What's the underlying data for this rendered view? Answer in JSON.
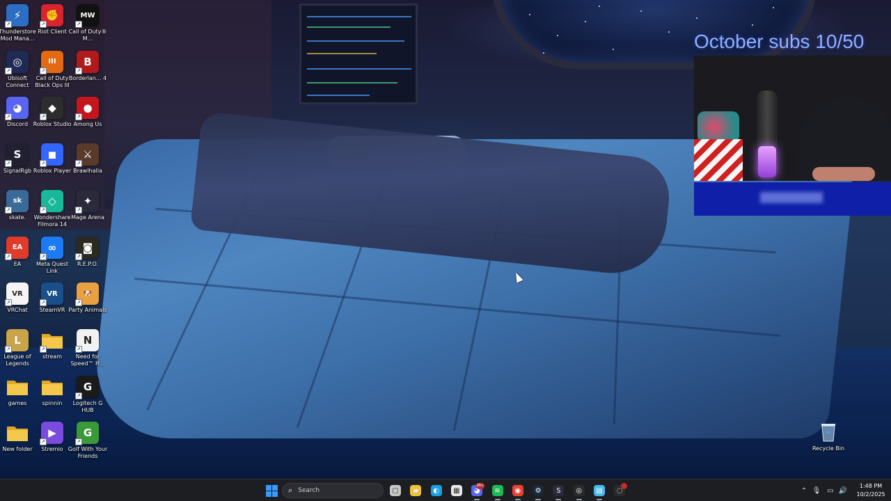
{
  "overlay": {
    "subs_goal_text": "October subs 10/50"
  },
  "desktop_icons": [
    {
      "label": "Thunderstore Mod Mana...",
      "icon": "thunderstore-icon",
      "color": "#2c6ec4",
      "glyph": "⚡"
    },
    {
      "label": "Riot Client",
      "icon": "riot-client-icon",
      "color": "#d8242e",
      "glyph": "✊"
    },
    {
      "label": "Call of Duty® M...",
      "icon": "call-of-duty-mw-icon",
      "color": "#111111",
      "glyph": "MW"
    },
    {
      "label": "Ubisoft Connect",
      "icon": "ubisoft-connect-icon",
      "color": "#1f2a55",
      "glyph": "◎"
    },
    {
      "label": "Call of Duty Black Ops III",
      "icon": "black-ops-3-icon",
      "color": "#e36a12",
      "glyph": "III"
    },
    {
      "label": "Borderlan... 4",
      "icon": "borderlands-icon",
      "color": "#b01a1a",
      "glyph": "B"
    },
    {
      "label": "Discord",
      "icon": "discord-icon",
      "color": "#5865f2",
      "glyph": "◕"
    },
    {
      "label": "Roblox Studio",
      "icon": "roblox-studio-icon",
      "color": "#2d2d2d",
      "glyph": "◆"
    },
    {
      "label": "Among Us",
      "icon": "among-us-icon",
      "color": "#c4161c",
      "glyph": "●"
    },
    {
      "label": "SignalRgb",
      "icon": "signalrgb-icon",
      "color": "#202030",
      "glyph": "S"
    },
    {
      "label": "Roblox Player",
      "icon": "roblox-player-icon",
      "color": "#3366ff",
      "glyph": "◼"
    },
    {
      "label": "Brawlhalla",
      "icon": "brawlhalla-icon",
      "color": "#5a3a2a",
      "glyph": "⚔"
    },
    {
      "label": "skate.",
      "icon": "skate-icon",
      "color": "#3a6a9a",
      "glyph": "sk"
    },
    {
      "label": "Wondershare Filmora 14",
      "icon": "filmora-icon",
      "color": "#18b89a",
      "glyph": "◇"
    },
    {
      "label": "Mage Arena",
      "icon": "mage-arena-icon",
      "color": "#2a2a3a",
      "glyph": "✦"
    },
    {
      "label": "EA",
      "icon": "ea-icon",
      "color": "#e03a2a",
      "glyph": "EA"
    },
    {
      "label": "Meta Quest Link",
      "icon": "meta-quest-link-icon",
      "color": "#1c7bf2",
      "glyph": "∞"
    },
    {
      "label": "R.E.P.O.",
      "icon": "repo-icon",
      "color": "#2a2a20",
      "glyph": "◙"
    },
    {
      "label": "VRChat",
      "icon": "vrchat-icon",
      "color": "#f5f5f5",
      "glyph": "VR"
    },
    {
      "label": "SteamVR",
      "icon": "steamvr-icon",
      "color": "#1b4f8a",
      "glyph": "VR"
    },
    {
      "label": "Party Animals",
      "icon": "party-animals-icon",
      "color": "#e8a040",
      "glyph": "🐶"
    },
    {
      "label": "League of Legends",
      "icon": "league-of-legends-icon",
      "color": "#c8a44a",
      "glyph": "L"
    },
    {
      "label": "stream",
      "icon": "folder-icon",
      "color": "#e9b83a",
      "glyph": ""
    },
    {
      "label": "Need for Speed™ H...",
      "icon": "need-for-speed-icon",
      "color": "#f2f2f2",
      "glyph": "N"
    },
    {
      "label": "games",
      "icon": "folder-icon",
      "color": "#e9b83a",
      "glyph": ""
    },
    {
      "label": "spinnin",
      "icon": "folder-icon",
      "color": "#e9b83a",
      "glyph": ""
    },
    {
      "label": "Logitech G HUB",
      "icon": "logitech-ghub-icon",
      "color": "#1a1a1a",
      "glyph": "G"
    },
    {
      "label": "New folder",
      "icon": "folder-icon",
      "color": "#e9b83a",
      "glyph": ""
    },
    {
      "label": "Stremio",
      "icon": "stremio-icon",
      "color": "#7b4be0",
      "glyph": "▶"
    },
    {
      "label": "Golf With Your Friends",
      "icon": "golf-with-friends-icon",
      "color": "#3a9a3a",
      "glyph": "G"
    }
  ],
  "recycle_bin": {
    "label": "Recycle Bin",
    "icon": "recycle-bin-icon"
  },
  "taskbar": {
    "search_placeholder": "Search",
    "apps": [
      {
        "name": "task-view-icon",
        "color": "#c8c8c8",
        "glyph": "▢"
      },
      {
        "name": "file-explorer-icon",
        "color": "#f0c040",
        "glyph": "▰"
      },
      {
        "name": "edge-icon",
        "color": "#1aa0e0",
        "glyph": "◐"
      },
      {
        "name": "microsoft-store-icon",
        "color": "#e8e8e8",
        "glyph": "▦"
      },
      {
        "name": "discord-taskbar-icon",
        "color": "#5865f2",
        "glyph": "◕",
        "badge": "99+"
      },
      {
        "name": "spotify-icon",
        "color": "#1db954",
        "glyph": "≋"
      },
      {
        "name": "chrome-icon",
        "color": "#e94235",
        "glyph": "◉"
      },
      {
        "name": "steam-icon",
        "color": "#1b2838",
        "glyph": "⚙"
      },
      {
        "name": "signalrgb-taskbar-icon",
        "color": "#2a2a3a",
        "glyph": "S"
      },
      {
        "name": "obs-icon",
        "color": "#2a2a2a",
        "glyph": "◎"
      },
      {
        "name": "notepad-icon",
        "color": "#4ab8e8",
        "glyph": "▤"
      },
      {
        "name": "snipping-tool-icon",
        "color": "#2a2a2a",
        "glyph": "◌",
        "badge": ""
      }
    ],
    "time": "1:48 PM",
    "date": "10/2/2025"
  }
}
